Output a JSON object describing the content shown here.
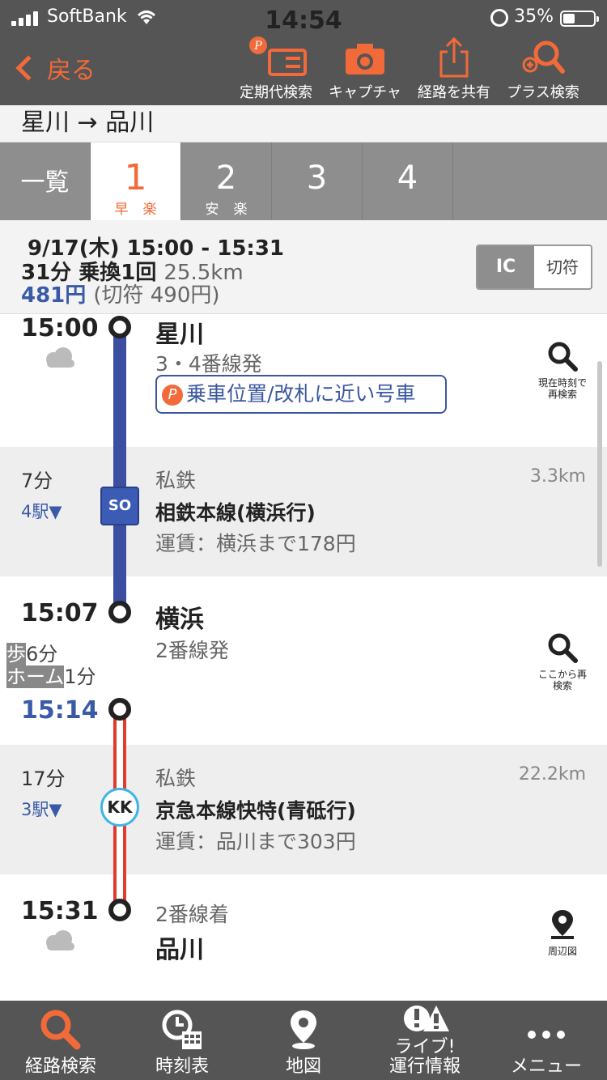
{
  "status": {
    "carrier": "SoftBank",
    "time": "14:54",
    "battery": "35%"
  },
  "header": {
    "back": "戻る",
    "tools": [
      "定期代検索",
      "キャプチャ",
      "経路を共有",
      "プラス検索"
    ]
  },
  "route": {
    "title": "星川 → 品川"
  },
  "tabs": [
    {
      "num": "一覧",
      "label": ""
    },
    {
      "num": "1",
      "label": "早楽"
    },
    {
      "num": "2",
      "label": "安楽"
    },
    {
      "num": "3",
      "label": ""
    },
    {
      "num": "4",
      "label": ""
    }
  ],
  "summary": {
    "line1": "9/17(木) 15:00 - 15:31",
    "duration": "31分 乗換1回",
    "distance": "25.5km",
    "fare": "481円",
    "ticket": "(切符 490円)",
    "toggle_ic": "IC",
    "toggle_ticket": "切符"
  },
  "timeline": {
    "dep_time": "15:00",
    "dep_station": "星川",
    "dep_platform": "3・4番線発",
    "position_btn": "乗車位置/改札に近い号車",
    "research_now": "現在時刻で再検索",
    "seg1": {
      "duration": "7分",
      "stops": "4駅▼",
      "type": "私鉄",
      "km": "3.3km",
      "line": "相鉄本線(横浜行)",
      "fare": "運賃：横浜まで178円",
      "badge": "SO"
    },
    "arr1_time": "15:07",
    "transfer_station": "横浜",
    "transfer_platform": "2番線発",
    "walk_label": "歩",
    "walk_time": "6分",
    "home_label": "ホーム",
    "home_time": "1分",
    "research_here": "ここから再検索",
    "dep2_time": "15:14",
    "seg2": {
      "duration": "17分",
      "stops": "3駅▼",
      "type": "私鉄",
      "km": "22.2km",
      "line": "京急本線快特(青砥行)",
      "fare": "運賃：品川まで303円",
      "badge": "KK"
    },
    "arr_time": "15:31",
    "arr_platform": "2番線着",
    "arr_station": "品川",
    "map_label": "周辺図"
  },
  "nav": [
    "経路検索",
    "時刻表",
    "地図",
    "ライブ!\n運行情報",
    "メニュー"
  ],
  "colors": {
    "accent": "#f26a39",
    "sotetsu": "#3c4ea0",
    "keikyu": "#e23a2e",
    "link": "#3a5aa8"
  }
}
